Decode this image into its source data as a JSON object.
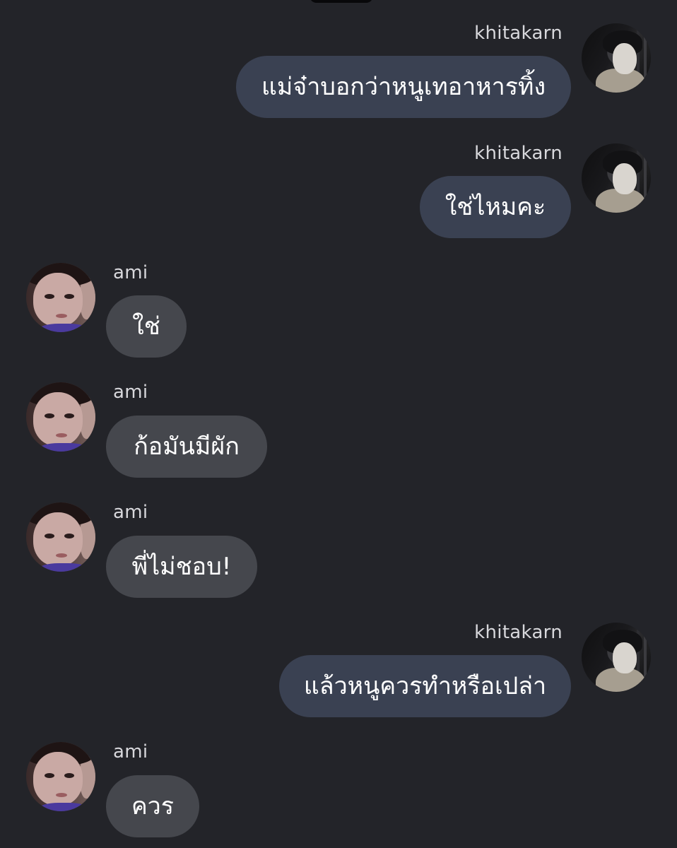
{
  "users": {
    "me": "khitakarn",
    "other": "ami"
  },
  "messages": [
    {
      "sender": "khitakarn",
      "side": "right",
      "text": "แม่จ๋าบอกว่าหนูเทอาหารทิ้ง"
    },
    {
      "sender": "khitakarn",
      "side": "right",
      "text": "ใช่ไหมคะ"
    },
    {
      "sender": "ami",
      "side": "left",
      "text": "ใช่"
    },
    {
      "sender": "ami",
      "side": "left",
      "text": "ก้อมันมีผัก"
    },
    {
      "sender": "ami",
      "side": "left",
      "text": "พี่ไม่ชอบ!"
    },
    {
      "sender": "khitakarn",
      "side": "right",
      "text": "แล้วหนูควรทำหรือเปล่า"
    },
    {
      "sender": "ami",
      "side": "left",
      "text": "ควร"
    }
  ],
  "colors": {
    "background": "#232429",
    "outgoing_bubble": "#3a4152",
    "incoming_bubble": "#45474d",
    "text": "#ffffff",
    "name": "#d8d8dc"
  }
}
